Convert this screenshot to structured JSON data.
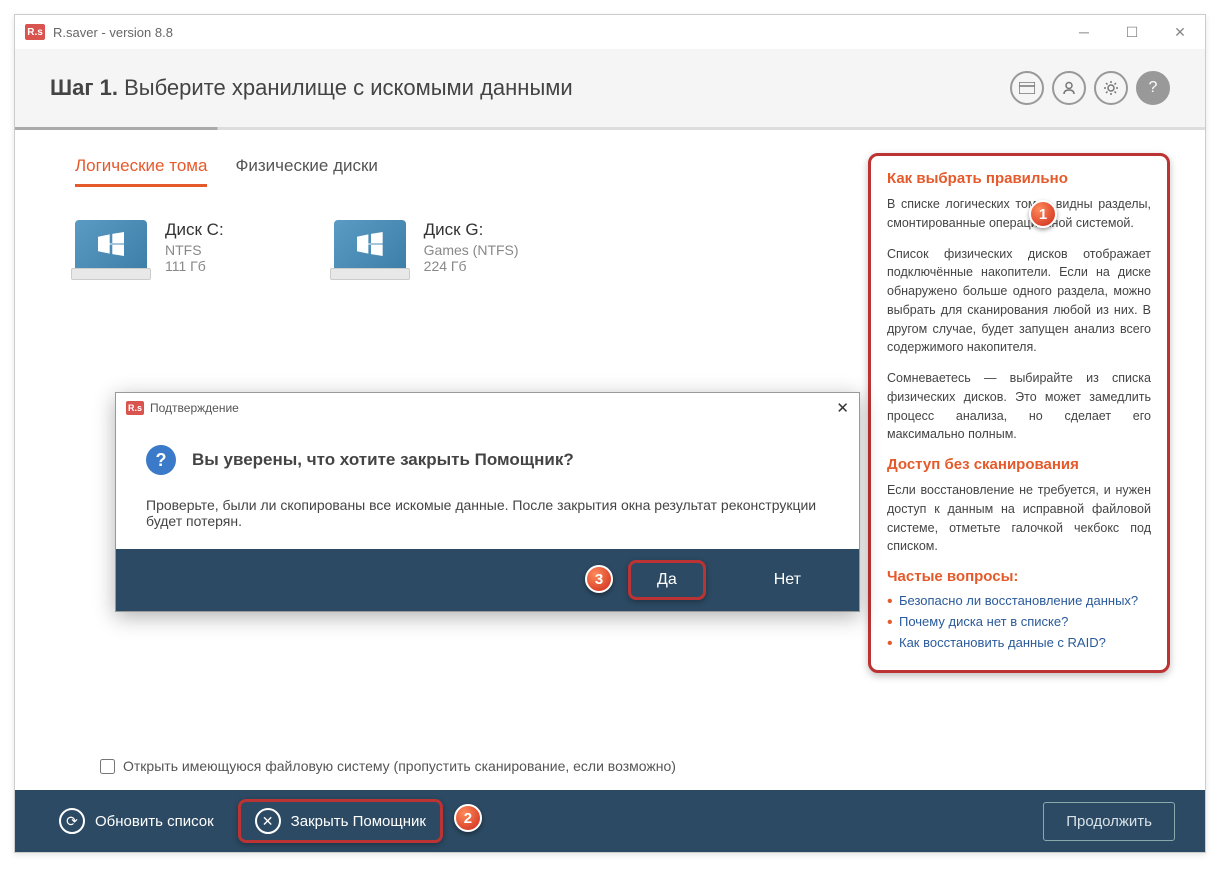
{
  "titlebar": {
    "logo": "R.s",
    "title": "R.saver - version 8.8"
  },
  "header": {
    "step_bold": "Шаг 1.",
    "step_rest": " Выберите хранилище с искомыми данными"
  },
  "tabs": {
    "logical": "Логические тома",
    "physical": "Физические диски"
  },
  "disks": [
    {
      "name": "Диск C:",
      "fs": "NTFS",
      "size": "111 Гб"
    },
    {
      "name": "Диск G:",
      "fs": "Games (NTFS)",
      "size": "224 Гб"
    }
  ],
  "side": {
    "h1": "Как выбрать правильно",
    "p1": "В списке логических томов видны разделы, смонтированные операционной системой.",
    "p2": "Список физических дисков отображает подключённые накопители. Если на диске обнаружено больше одного раздела, можно выбрать для сканирования любой из них. В другом случае, будет запущен анализ всего содержимого накопителя.",
    "p3": "Сомневаетесь — выбирайте из списка физических дисков. Это может замедлить процесс анализа, но сделает его максимально полным.",
    "h2": "Доступ без сканирования",
    "p4": "Если восстановление не требуется, и нужен доступ к данным на исправной файловой системе, отметьте галочкой чекбокс под списком.",
    "h3": "Частые вопросы:",
    "faq": [
      "Безопасно ли восстановление данных?",
      "Почему диска нет в списке?",
      "Как восстановить данные с RAID?"
    ]
  },
  "checkbox": "Открыть имеющуюся файловую систему (пропустить сканирование, если возможно)",
  "footer": {
    "refresh": "Обновить список",
    "close": "Закрыть Помощник",
    "continue": "Продолжить"
  },
  "dialog": {
    "title": "Подтверждение",
    "logo": "R.s",
    "question": "Вы уверены, что хотите закрыть Помощник?",
    "message": "Проверьте, были ли скопированы все искомые данные. После закрытия окна результат реконструкции будет потерян.",
    "yes": "Да",
    "no": "Нет"
  },
  "badges": {
    "b1": "1",
    "b2": "2",
    "b3": "3"
  }
}
